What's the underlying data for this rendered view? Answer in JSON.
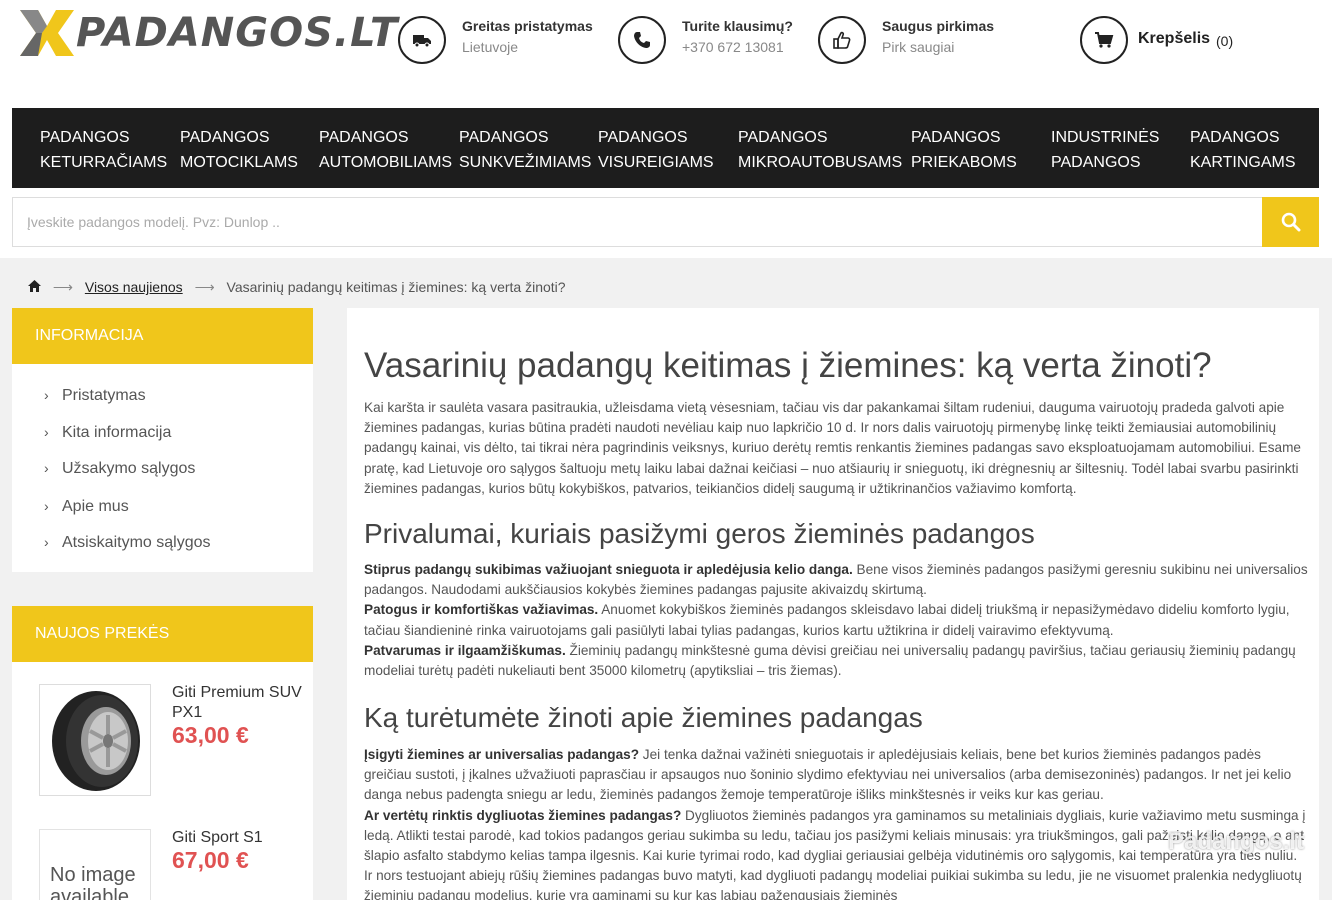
{
  "logo": {
    "text": "PADANGOS.LT",
    "alt": "Padangos.lt logo"
  },
  "header_info": [
    {
      "title": "Greitas pristatymas",
      "subtitle": "Lietuvoje",
      "icon": "truck-icon"
    },
    {
      "title": "Turite klausimų?",
      "subtitle": "+370 672 13081",
      "icon": "phone-icon"
    },
    {
      "title": "Saugus pirkimas",
      "subtitle": "Pirk saugiai",
      "icon": "thumbs-up-icon"
    }
  ],
  "cart": {
    "label": "Krepšelis",
    "count": "(0)",
    "icon": "cart-icon"
  },
  "nav": [
    {
      "line1": "PADANGOS",
      "line2": "KETURRAČIAMS"
    },
    {
      "line1": "PADANGOS",
      "line2": "MOTOCIKLAMS"
    },
    {
      "line1": "PADANGOS",
      "line2": "AUTOMOBILIAMS"
    },
    {
      "line1": "PADANGOS",
      "line2": "SUNKVEŽIMIAMS"
    },
    {
      "line1": "PADANGOS",
      "line2": "VISUREIGIAMS"
    },
    {
      "line1": "PADANGOS",
      "line2": "MIKROAUTOBUSAMS"
    },
    {
      "line1": "PADANGOS",
      "line2": "PRIEKABOMS"
    },
    {
      "line1": "INDUSTRINĖS",
      "line2": "PADANGOS"
    },
    {
      "line1": "PADANGOS",
      "line2": "KARTINGAMS"
    }
  ],
  "search": {
    "placeholder": "Įveskite padangos modelį. Pvz: Dunlop ..",
    "value": ""
  },
  "breadcrumb": {
    "link": "Visos naujienos",
    "current": "Vasarinių padangų keitimas į žiemines: ką verta žinoti?"
  },
  "sidebar": {
    "info_title": "INFORMACIJA",
    "info_items": [
      "Pristatymas",
      "Kita informacija",
      "Užsakymo sąlygos",
      "Apie mus",
      "Atsiskaitymo sąlygos"
    ],
    "new_title": "NAUJOS PREKĖS",
    "products": [
      {
        "name": "Giti Premium SUV PX1",
        "price": "63,00 €"
      },
      {
        "name": "Giti Sport S1",
        "price": "67,00 €",
        "image_text": "No image available"
      }
    ]
  },
  "article": {
    "title": "Vasarinių padangų keitimas į žiemines: ką verta žinoti?",
    "intro": "Kai karšta ir saulėta vasara pasitraukia, užleisdama vietą vėsesniam, tačiau vis dar pakankamai šiltam rudeniui, dauguma vairuotojų pradeda galvoti apie žiemines padangas, kurias būtina pradėti naudoti nevėliau kaip nuo lapkričio 10 d. Ir nors dalis vairuotojų pirmenybę linkę teikti žemiausiai automobilinių padangų kainai, vis dėlto, tai tikrai nėra pagrindinis veiksnys, kuriuo derėtų remtis renkantis žiemines padangas savo eksploatuojamam automobiliui. Esame pratę, kad Lietuvoje oro sąlygos šaltuoju metų laiku labai dažnai keičiasi – nuo atšiaurių ir snieguotų, iki drėgnesnių ar šiltesnių. Todėl labai svarbu pasirinkti žiemines padangas, kurios būtų kokybiškos, patvarios, teikiančios didelį saugumą ir užtikrinančios važiavimo komfortą.",
    "h2_1": "Privalumai, kuriais pasižymi geros žieminės padangos",
    "p1_b": "Stiprus padangų sukibimas važiuojant snieguota ir apledėjusia kelio danga.",
    "p1": " Bene visos žieminės padangos pasižymi geresniu sukibinu nei universalios padangos. Naudodami aukščiausios kokybės žiemines padangas pajusite akivaizdų skirtumą.",
    "p2_b": "Patogus ir komfortiškas važiavimas.",
    "p2": " Anuomet kokybiškos žieminės padangos skleisdavo labai didelį triukšmą ir nepasižymėdavo dideliu komforto lygiu, tačiau šiandieninė rinka vairuotojams gali pasiūlyti labai tylias padangas, kurios kartu užtikrina ir didelį vairavimo efektyvumą.",
    "p3_b": "Patvarumas ir ilgaamžiškumas.",
    "p3": " Žieminių padangų minkštesnė guma dėvisi greičiau nei universalių padangų paviršius, tačiau geriausių žieminių padangų modeliai turėtų padėti nukeliauti bent 35000 kilometrų (apytiksliai – tris žiemas).",
    "h2_2": "Ką turėtumėte žinoti apie žiemines padangas",
    "p4_b": "Įsigyti žiemines ar universalias padangas?",
    "p4": " Jei tenka dažnai važinėti snieguotais ir apledėjusiais keliais, bene bet kurios žieminės padangos padės greičiau sustoti, į įkalnes užvažiuoti paprasčiau ir apsaugos nuo šoninio slydimo efektyviau nei universalios (arba demisezoninės) padangos. Ir net jei kelio danga nebus padengta sniegu ar ledu, žieminės padangos žemoje temperatūroje išliks minkštesnės ir veiks kur kas geriau.",
    "p5_b": "Ar vertėtų rinktis dygliuotas žiemines padangas?",
    "p5": " Dygliuotos žieminės padangos yra gaminamos su metaliniais dygliais, kurie važiavimo metu susminga į ledą. Atlikti testai parodė, kad tokios padangos geriau sukimba su ledu, tačiau jos pasižymi keliais minusais: yra triukšmingos, gali pažeisti kelio dangą, o ant šlapio asfalto stabdymo kelias tampa ilgesnis. Kai kurie tyrimai rodo, kad dygliai geriausiai gelbėja vidutinėmis oro sąlygomis, kai temperatūra yra ties nuliu. Ir nors testuojant abiejų rūšių žiemines padangas buvo matyti, kad dygliuoti padangų modeliai puikiai sukimba su ledu, jie ne visuomet pralenkia nedygliuotų žieminių padangų modelius, kurie yra gaminami su kur kas labiau pažengusiais žieminės"
  },
  "watermark": "Padangos.lt",
  "colors": {
    "accent": "#f0c61b",
    "nav_bg": "#1d1d1d",
    "price": "#e05252"
  }
}
